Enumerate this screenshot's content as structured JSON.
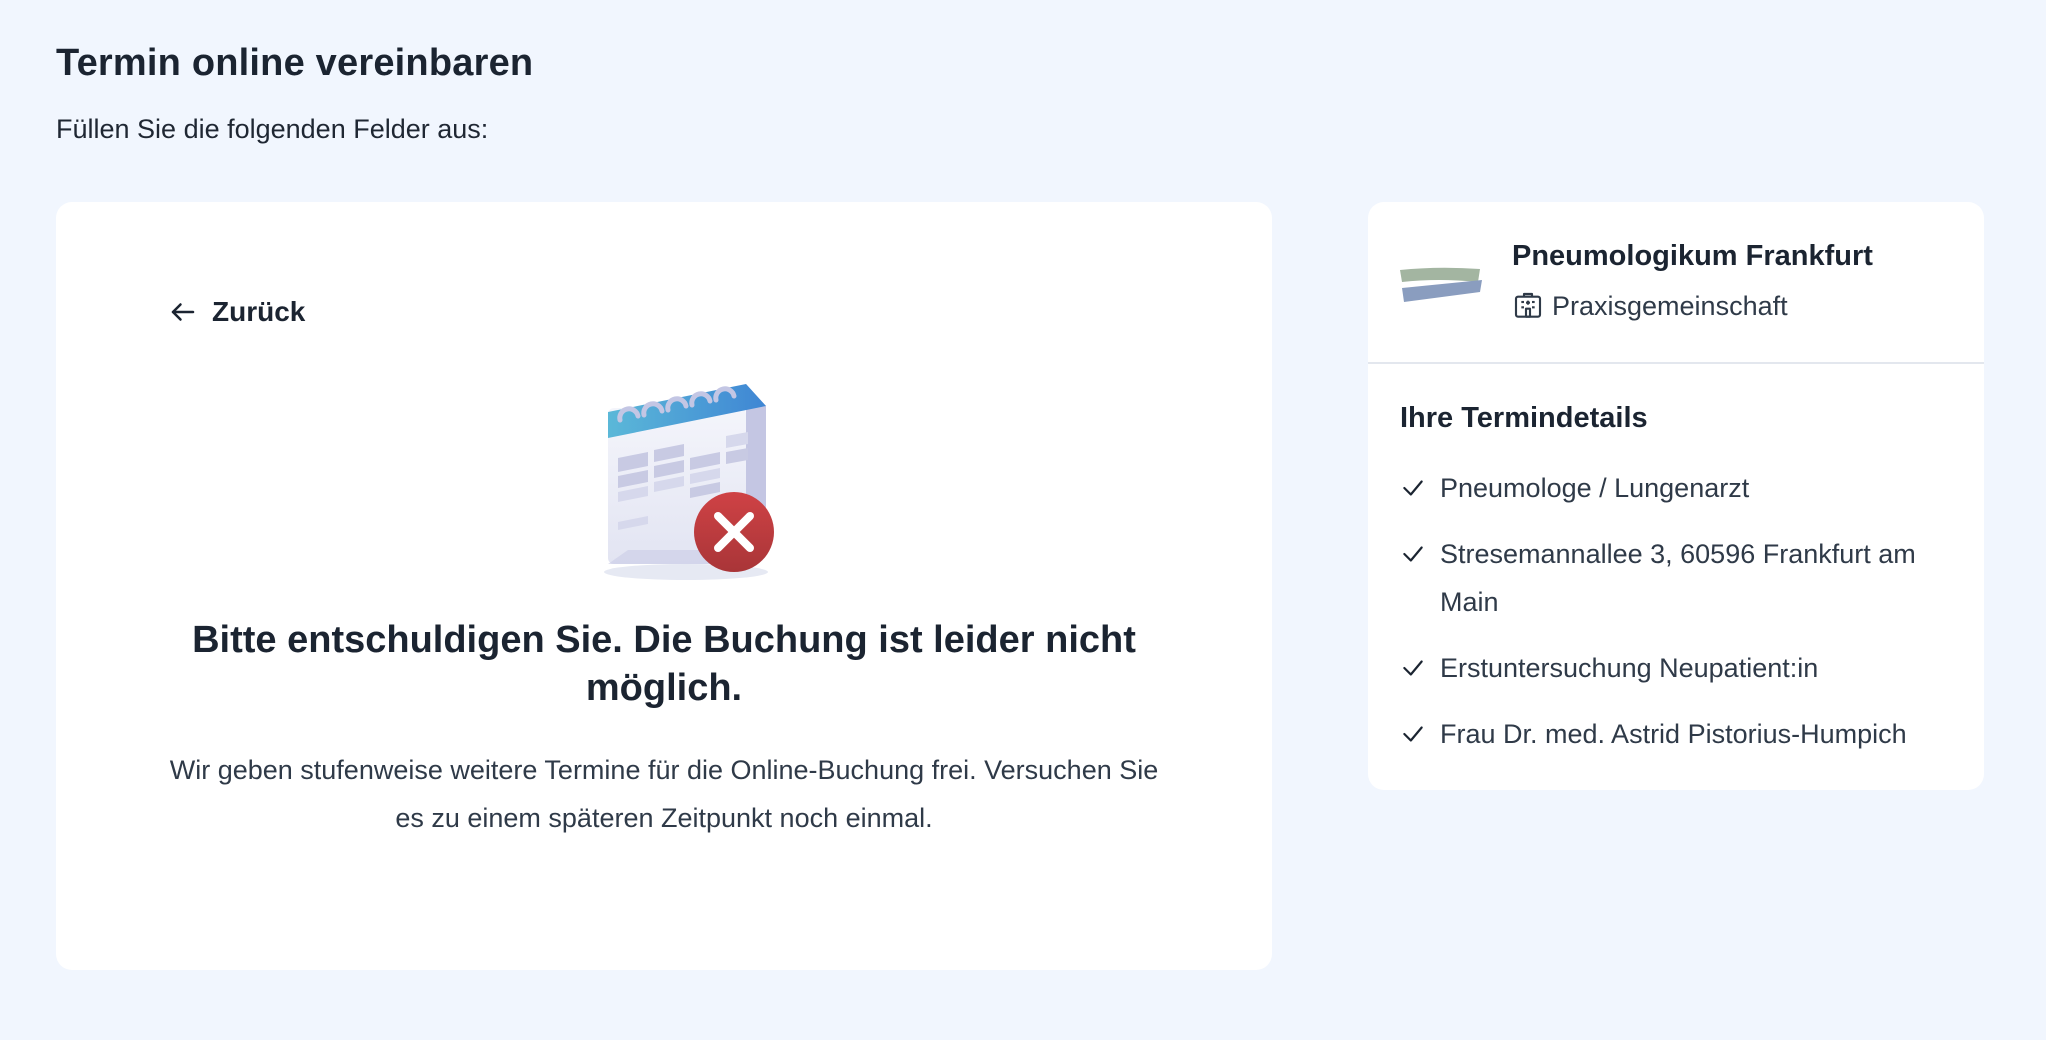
{
  "page": {
    "title": "Termin online vereinbaren",
    "subtitle": "Füllen Sie die folgenden Felder aus:"
  },
  "main": {
    "back_label": "Zurück",
    "back_icon": "arrow-left-icon",
    "illustration_icon": "calendar-error-icon",
    "error_title": "Bitte entschuldigen Sie. Die Buchung ist leider nicht möglich.",
    "error_text": "Wir geben stufenweise weitere Termine für die Online-Buchung frei. Versuchen Sie es zu einem späteren Zeitpunkt noch einmal."
  },
  "sidebar": {
    "practice_name": "Pneumologikum Frankfurt",
    "practice_type": "Praxisgemeinschaft",
    "practice_type_icon": "building-icon",
    "details_title": "Ihre Termindetails",
    "details": [
      "Pneumologe / Lungenarzt",
      "Stresemannallee 3, 60596 Frankfurt am Main",
      "Erstuntersuchung Neupatient:in",
      "Frau Dr. med. Astrid Pistorius-Humpich"
    ]
  },
  "colors": {
    "background": "#f1f6fe",
    "card": "#ffffff",
    "text_primary": "#1b2431",
    "error_red": "#c0393f",
    "calendar_blue": "#4a9bd9"
  }
}
